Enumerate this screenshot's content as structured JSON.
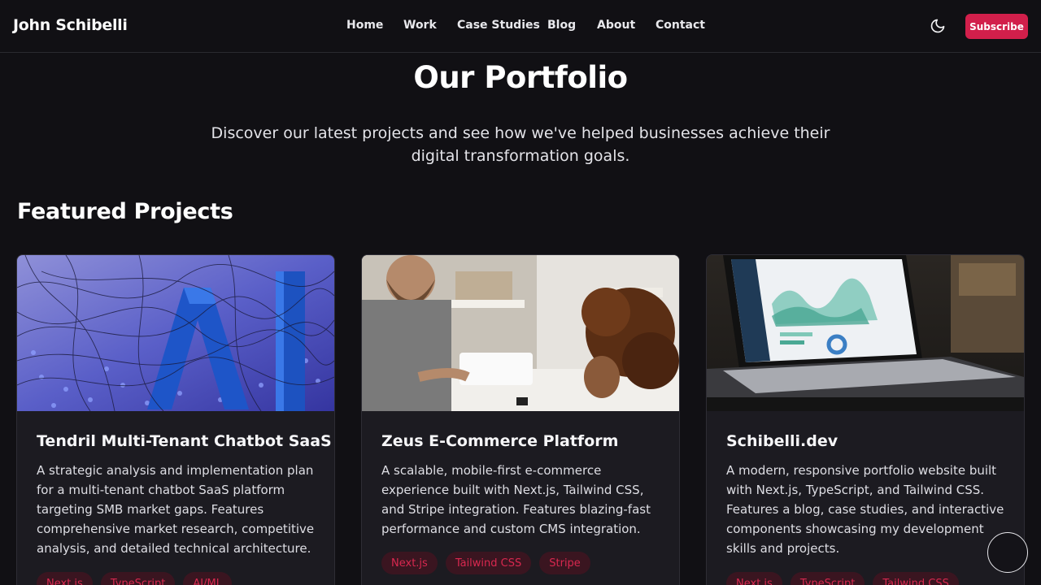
{
  "header": {
    "brand": "John Schibelli",
    "nav": [
      "Home",
      "Work",
      "Case Studies",
      "Blog",
      "About",
      "Contact"
    ],
    "theme_icon": "moon-icon",
    "subscribe_label": "Subscribe",
    "accent": "#d21f4b"
  },
  "hero": {
    "title": "Our Portfolio",
    "subtitle": "Discover our latest projects and see how we've helped businesses achieve their digital transformation goals."
  },
  "featured": {
    "title": "Featured Projects",
    "cards": [
      {
        "title": "Tendril Multi-Tenant Chatbot SaaS",
        "description": "A strategic analysis and implementation plan for a multi-tenant chatbot SaaS platform targeting SMB market gaps. Features comprehensive market research, competitive analysis, and detailed technical architecture.",
        "tags": [
          "Next.js",
          "TypeScript",
          "AI/ML"
        ],
        "image": "ai-network-illustration"
      },
      {
        "title": "Zeus E-Commerce Platform",
        "description": "A scalable, mobile-first e-commerce experience built with Next.js, Tailwind CSS, and Stripe integration. Features blazing-fast performance and custom CMS integration.",
        "tags": [
          "Next.js",
          "Tailwind CSS",
          "Stripe"
        ],
        "image": "retail-checkout-photo"
      },
      {
        "title": "Schibelli.dev",
        "description": "A modern, responsive portfolio website built with Next.js, TypeScript, and Tailwind CSS. Features a blog, case studies, and interactive components showcasing my development skills and projects.",
        "tags": [
          "Next.js",
          "TypeScript",
          "Tailwind CSS"
        ],
        "image": "laptop-dashboard-photo"
      }
    ]
  },
  "floating_button": "scroll-button"
}
